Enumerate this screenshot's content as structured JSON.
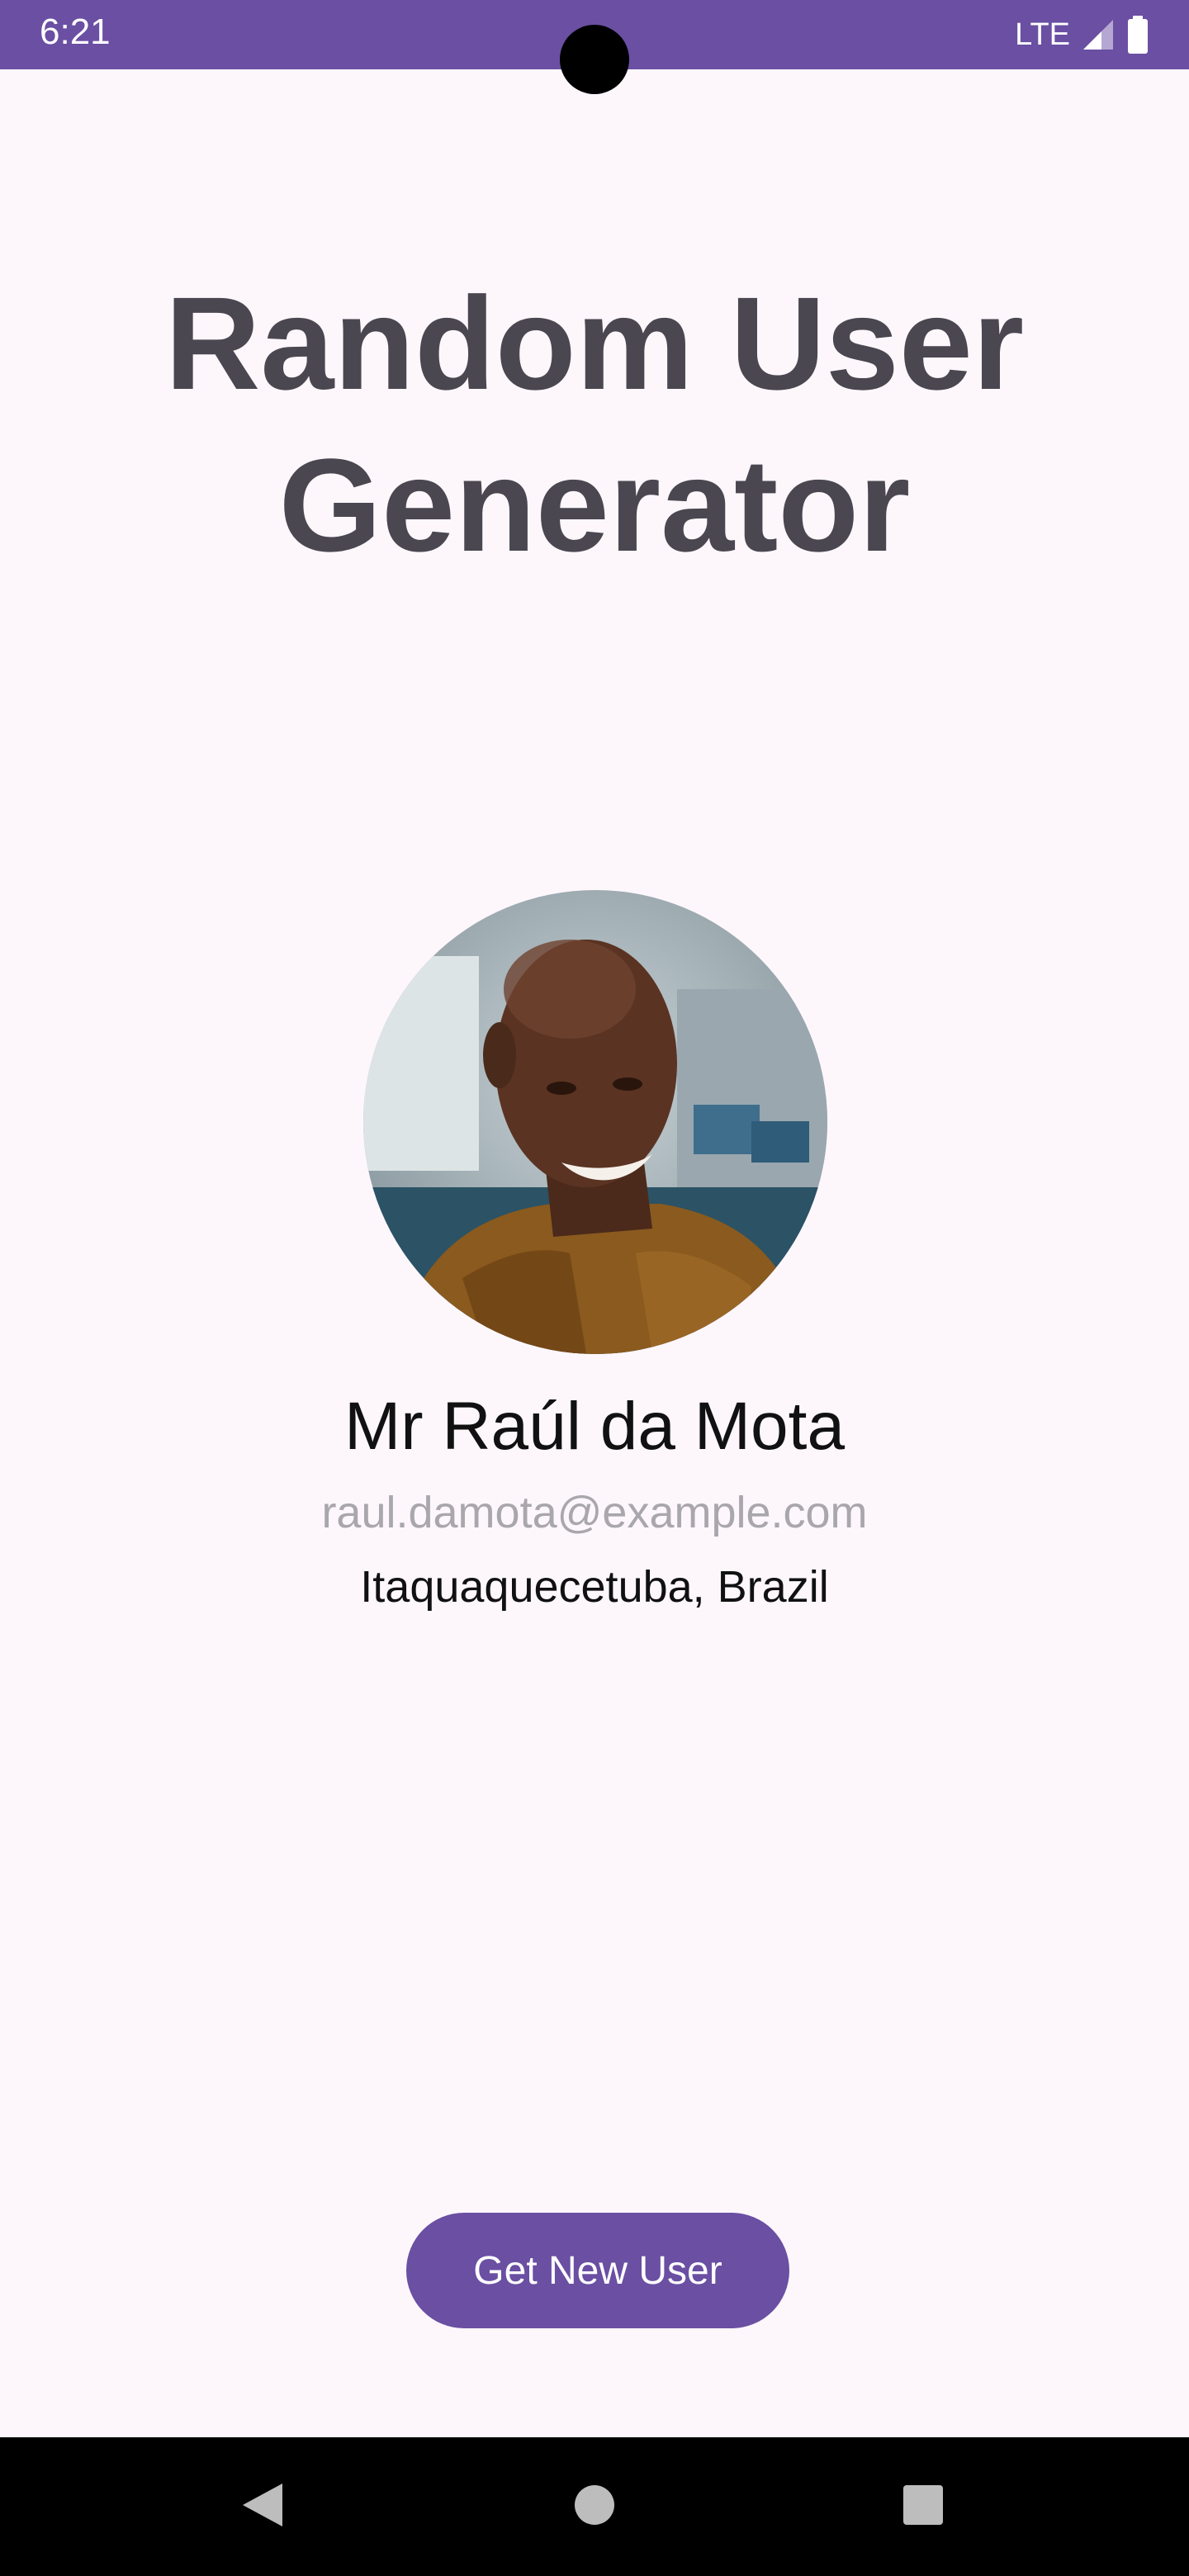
{
  "status_bar": {
    "time": "6:21",
    "network": "LTE",
    "background_color": "#6A4FA3",
    "icons": [
      "signal-icon",
      "battery-icon"
    ]
  },
  "title": {
    "line1": "Random User",
    "line2": "Generator"
  },
  "user": {
    "avatar_icon": "user-photo",
    "name": "Mr Raúl da Mota",
    "email": "raul.damota@example.com",
    "location": "Itaquaquecetuba, Brazil"
  },
  "actions": {
    "new_user_label": "Get New User",
    "button_color": "#6A4FA3"
  },
  "nav_bar": {
    "icons": [
      "back-icon",
      "home-icon",
      "recents-icon"
    ]
  },
  "colors": {
    "background": "#FDF7FC",
    "title_text": "#4A4750",
    "email_text": "#A9A6AC"
  }
}
